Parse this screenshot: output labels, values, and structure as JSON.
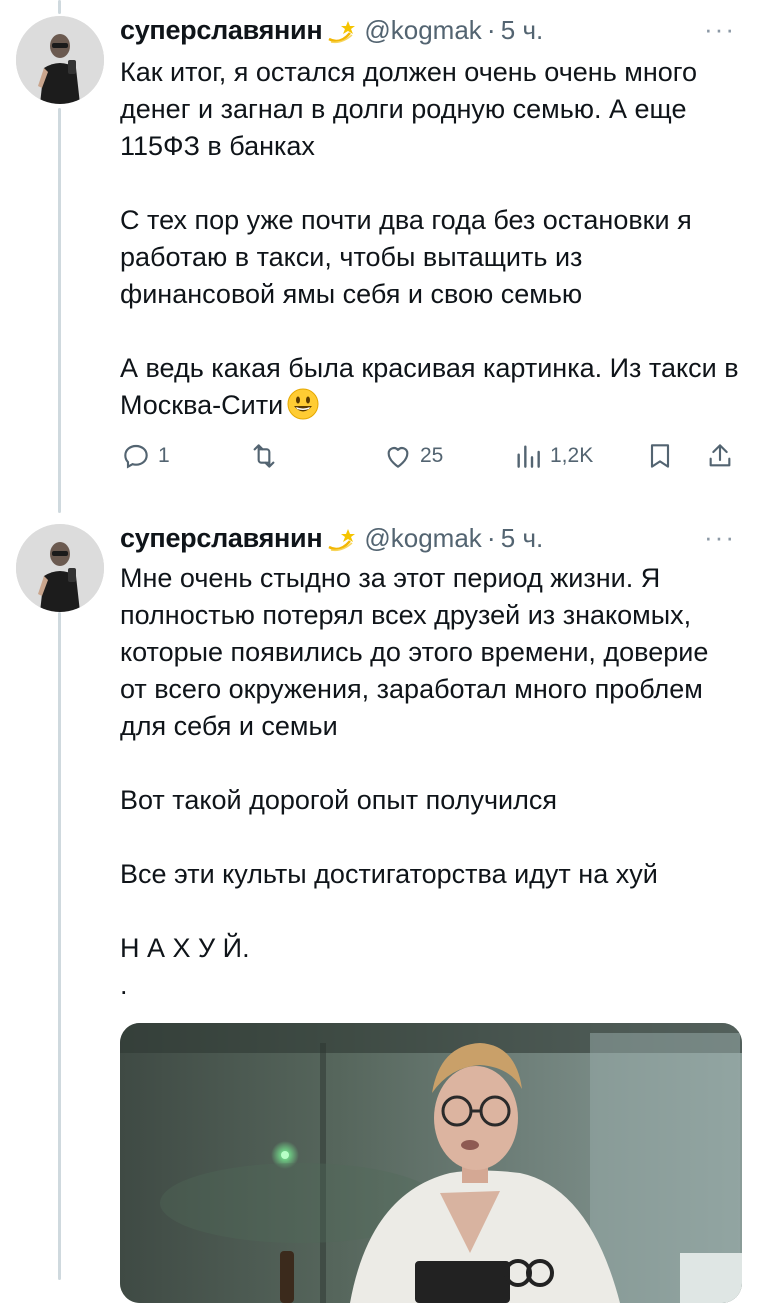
{
  "tweets": [
    {
      "author": {
        "display_name": "суперславянин",
        "handle": "@kogmak",
        "time": "5 ч.",
        "badge_icon": "shooting-star-icon"
      },
      "paragraphs": [
        "Как итог, я остался должен очень очень много денег и загнал в долги родную семью. А еще 115ФЗ в банках",
        "С тех пор уже почти два года без остановки я работаю в такси, чтобы вытащить из финансовой ямы себя и свою семью",
        "А ведь какая была красивая картинка. Из такси в Москва-Сити"
      ],
      "end_emoji": "grinning-face-icon",
      "actions": {
        "replies": "1",
        "retweets": "",
        "likes": "25",
        "views": "1,2K"
      }
    },
    {
      "author": {
        "display_name": "суперславянин",
        "handle": "@kogmak",
        "time": "5 ч.",
        "badge_icon": "shooting-star-icon"
      },
      "paragraphs": [
        "Мне очень стыдно за этот период жизни. Я полностью потерял всех друзей из знакомых, которые появились до этого времени, доверие от всего окружения, заработал много проблем для себя и семьи",
        "Вот такой дорогой опыт получился",
        "Все эти культы достигаторства идут на хуй",
        "Н А Х У Й.",
        "."
      ]
    }
  ],
  "colors": {
    "text": "#0f1419",
    "secondary": "#536471",
    "thread_line": "#cfd9de"
  }
}
